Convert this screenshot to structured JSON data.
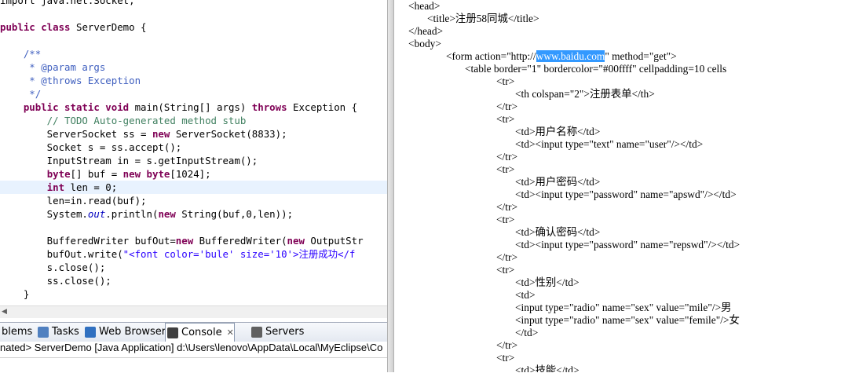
{
  "editor": {
    "lines": [
      {
        "parts": [
          {
            "t": "import java.net.Socket;",
            "c": ""
          }
        ]
      },
      {
        "parts": [
          {
            "t": "",
            "c": ""
          }
        ]
      },
      {
        "parts": [
          {
            "t": "public class",
            "c": "kw"
          },
          {
            "t": " ServerDemo {",
            "c": ""
          }
        ]
      },
      {
        "parts": [
          {
            "t": "",
            "c": ""
          }
        ]
      },
      {
        "parts": [
          {
            "t": "    /**",
            "c": "jd"
          }
        ]
      },
      {
        "parts": [
          {
            "t": "     * @param args",
            "c": "jd"
          }
        ]
      },
      {
        "parts": [
          {
            "t": "     * @throws Exception",
            "c": "jd"
          }
        ]
      },
      {
        "parts": [
          {
            "t": "     */",
            "c": "jd"
          }
        ]
      },
      {
        "parts": [
          {
            "t": "    public static void",
            "c": "kw"
          },
          {
            "t": " main(String[] args) ",
            "c": ""
          },
          {
            "t": "throws",
            "c": "kw"
          },
          {
            "t": " Exception {",
            "c": ""
          }
        ]
      },
      {
        "parts": [
          {
            "t": "        // TODO Auto-generated method stub",
            "c": "cm"
          }
        ]
      },
      {
        "parts": [
          {
            "t": "        ServerSocket ss = ",
            "c": ""
          },
          {
            "t": "new",
            "c": "kw"
          },
          {
            "t": " ServerSocket(8833);",
            "c": ""
          }
        ]
      },
      {
        "parts": [
          {
            "t": "        Socket s = ss.accept();",
            "c": ""
          }
        ]
      },
      {
        "parts": [
          {
            "t": "        InputStream in = s.getInputStream();",
            "c": ""
          }
        ]
      },
      {
        "parts": [
          {
            "t": "        ",
            "c": ""
          },
          {
            "t": "byte",
            "c": "kw"
          },
          {
            "t": "[] buf = ",
            "c": ""
          },
          {
            "t": "new",
            "c": "kw"
          },
          {
            "t": " ",
            "c": ""
          },
          {
            "t": "byte",
            "c": "kw"
          },
          {
            "t": "[1024];",
            "c": ""
          }
        ]
      },
      {
        "parts": [
          {
            "t": "        ",
            "c": ""
          },
          {
            "t": "int",
            "c": "kw"
          },
          {
            "t": " len = 0;",
            "c": ""
          }
        ],
        "highlight": true
      },
      {
        "parts": [
          {
            "t": "        len=in.read(buf);",
            "c": ""
          }
        ]
      },
      {
        "parts": [
          {
            "t": "        System.",
            "c": ""
          },
          {
            "t": "out",
            "c": "fld"
          },
          {
            "t": ".println(",
            "c": ""
          },
          {
            "t": "new",
            "c": "kw"
          },
          {
            "t": " String(buf,0,len));",
            "c": ""
          }
        ]
      },
      {
        "parts": [
          {
            "t": "",
            "c": ""
          }
        ]
      },
      {
        "parts": [
          {
            "t": "        BufferedWriter bufOut=",
            "c": ""
          },
          {
            "t": "new",
            "c": "kw"
          },
          {
            "t": " BufferedWriter(",
            "c": ""
          },
          {
            "t": "new",
            "c": "kw"
          },
          {
            "t": " OutputStr",
            "c": ""
          }
        ]
      },
      {
        "parts": [
          {
            "t": "        bufOut.write(",
            "c": ""
          },
          {
            "t": "\"<font color='bule' size='10'>注册成功</f",
            "c": "str"
          }
        ]
      },
      {
        "parts": [
          {
            "t": "        s.close();",
            "c": ""
          }
        ]
      },
      {
        "parts": [
          {
            "t": "        ss.close();",
            "c": ""
          }
        ]
      },
      {
        "parts": [
          {
            "t": "    }",
            "c": ""
          }
        ]
      }
    ]
  },
  "view_tabs": [
    {
      "label": "blems",
      "icon": "problems-icon",
      "color": "#d04040"
    },
    {
      "label": "Tasks",
      "icon": "tasks-icon",
      "color": "#5080c0"
    },
    {
      "label": "Web Browser",
      "icon": "globe-icon",
      "color": "#3070c0"
    },
    {
      "label": "Console",
      "icon": "console-icon",
      "color": "#404040",
      "close": "✕"
    },
    {
      "label": "Servers",
      "icon": "servers-icon",
      "color": "#606060"
    }
  ],
  "console": {
    "text": "nated> ServerDemo [Java Application] d:\\Users\\lenovo\\AppData\\Local\\MyEclipse\\Co"
  },
  "source": {
    "lines": [
      {
        "indent": 0,
        "text": "<head>"
      },
      {
        "indent": 1,
        "text": "<title>注册58同城</title>"
      },
      {
        "indent": 0,
        "text": "</head>"
      },
      {
        "indent": 0,
        "text": "<body>"
      },
      {
        "indent": 2,
        "pre": "<form action=\"http://",
        "sel": "www.baidu.com",
        "post": "\" method=\"get\">"
      },
      {
        "indent": 3,
        "text": "<table border=\"1\" bordercolor=\"#00ffff\" cellpadding=10 cells"
      },
      {
        "indent": 4,
        "text": "<tr>"
      },
      {
        "indent": 5,
        "text": "<th colspan=\"2\">注册表单</th>"
      },
      {
        "indent": 4,
        "text": "</tr>"
      },
      {
        "indent": 4,
        "text": "<tr>"
      },
      {
        "indent": 5,
        "text": "<td>用户名称</td>"
      },
      {
        "indent": 5,
        "text": "<td><input type=\"text\" name=\"user\"/></td>"
      },
      {
        "indent": 4,
        "text": "</tr>"
      },
      {
        "indent": 4,
        "text": "<tr>"
      },
      {
        "indent": 5,
        "text": "<td>用户密码</td>"
      },
      {
        "indent": 5,
        "text": "<td><input type=\"password\" name=\"apswd\"/></td>"
      },
      {
        "indent": 4,
        "text": "</tr>"
      },
      {
        "indent": 4,
        "text": "<tr>"
      },
      {
        "indent": 5,
        "text": "<td>确认密码</td>"
      },
      {
        "indent": 5,
        "text": "<td><input type=\"password\" name=\"repswd\"/></td>"
      },
      {
        "indent": 4,
        "text": "</tr>"
      },
      {
        "indent": 4,
        "text": "<tr>"
      },
      {
        "indent": 5,
        "text": "<td>性别</td>"
      },
      {
        "indent": 5,
        "text": "<td>"
      },
      {
        "indent": 5,
        "text": "<input type=\"radio\" name=\"sex\" value=\"mile\"/>男"
      },
      {
        "indent": 5,
        "text": "<input type=\"radio\" name=\"sex\" value=\"femile\"/>女"
      },
      {
        "indent": 5,
        "text": "</td>"
      },
      {
        "indent": 4,
        "text": "</tr>"
      },
      {
        "indent": 4,
        "text": "<tr>"
      },
      {
        "indent": 5,
        "text": "<td>技能</td>"
      }
    ]
  }
}
